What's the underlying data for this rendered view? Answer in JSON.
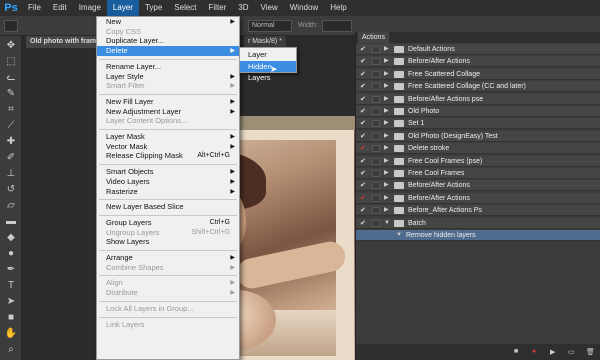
{
  "app_logo": "Ps",
  "menu": [
    "File",
    "Edit",
    "Image",
    "Layer",
    "Type",
    "Select",
    "Filter",
    "3D",
    "View",
    "Window",
    "Help"
  ],
  "active_menu": "Layer",
  "options_bar": {
    "mode_value": "Normal",
    "width_label": "Width:"
  },
  "document_tab": "Old photo with frame",
  "document_tab_suffix": "r Mask/8) *",
  "layer_menu": [
    {
      "label": "New",
      "arrow": true
    },
    {
      "label": "Copy CSS",
      "disabled": true
    },
    {
      "label": "Duplicate Layer..."
    },
    {
      "label": "Delete",
      "arrow": true,
      "highlighted": true
    },
    {
      "sep": true
    },
    {
      "label": "Rename Layer..."
    },
    {
      "label": "Layer Style",
      "arrow": true
    },
    {
      "label": "Smart Filter",
      "arrow": true,
      "disabled": true
    },
    {
      "sep": true
    },
    {
      "label": "New Fill Layer",
      "arrow": true
    },
    {
      "label": "New Adjustment Layer",
      "arrow": true
    },
    {
      "label": "Layer Content Options...",
      "disabled": true
    },
    {
      "sep": true
    },
    {
      "label": "Layer Mask",
      "arrow": true
    },
    {
      "label": "Vector Mask",
      "arrow": true
    },
    {
      "label": "Release Clipping Mask",
      "shortcut": "Alt+Ctrl+G"
    },
    {
      "sep": true
    },
    {
      "label": "Smart Objects",
      "arrow": true
    },
    {
      "label": "Video Layers",
      "arrow": true
    },
    {
      "label": "Rasterize",
      "arrow": true
    },
    {
      "sep": true
    },
    {
      "label": "New Layer Based Slice"
    },
    {
      "sep": true
    },
    {
      "label": "Group Layers",
      "shortcut": "Ctrl+G"
    },
    {
      "label": "Ungroup Layers",
      "shortcut": "Shift+Ctrl+G",
      "disabled": true
    },
    {
      "label": "Show Layers"
    },
    {
      "sep": true
    },
    {
      "label": "Arrange",
      "arrow": true
    },
    {
      "label": "Combine Shapes",
      "arrow": true,
      "disabled": true
    },
    {
      "sep": true
    },
    {
      "label": "Align",
      "arrow": true,
      "disabled": true
    },
    {
      "label": "Distribute",
      "arrow": true,
      "disabled": true
    },
    {
      "sep": true
    },
    {
      "label": "Lock All Layers in Group...",
      "disabled": true
    },
    {
      "sep": true
    },
    {
      "label": "Link Layers",
      "disabled": true
    }
  ],
  "delete_submenu": [
    {
      "label": "Layer"
    },
    {
      "label": "Hidden Layers",
      "highlighted": true
    }
  ],
  "actions_panel": {
    "title": "Actions",
    "rows": [
      {
        "label": "Default Actions",
        "check_red": false,
        "expanded": false,
        "folder": true
      },
      {
        "label": "Before/After Actions",
        "check_red": false,
        "expanded": false,
        "folder": true
      },
      {
        "label": "Free Scattered Collage",
        "check_red": false,
        "expanded": false,
        "folder": true
      },
      {
        "label": "Free Scattered Collage (CC and later)",
        "check_red": false,
        "expanded": false,
        "folder": true
      },
      {
        "label": "Before/After Actions pse",
        "check_red": false,
        "expanded": false,
        "folder": true
      },
      {
        "label": "Old Photo",
        "check_red": false,
        "expanded": false,
        "folder": true
      },
      {
        "label": "Set 1",
        "check_red": false,
        "expanded": false,
        "folder": true
      },
      {
        "label": "Old Photo (DesignEasy) Test",
        "check_red": false,
        "expanded": false,
        "folder": true
      },
      {
        "label": "Delete stroke",
        "check_red": true,
        "expanded": false,
        "folder": true
      },
      {
        "label": "Free Cool Frames (pse)",
        "check_red": false,
        "expanded": false,
        "folder": true
      },
      {
        "label": "Free Cool Frames",
        "check_red": false,
        "expanded": false,
        "folder": true
      },
      {
        "label": "Before/After Actions",
        "check_red": false,
        "expanded": false,
        "folder": true
      },
      {
        "label": "Before/After Actions",
        "check_red": true,
        "expanded": false,
        "folder": true
      },
      {
        "label": "Before_After Actions Ps",
        "check_red": false,
        "expanded": false,
        "folder": true
      },
      {
        "label": "Batch",
        "check_red": false,
        "expanded": true,
        "folder": true
      },
      {
        "label": "Remove hidden layers",
        "check_red": false,
        "expanded": true,
        "folder": false,
        "selected": true
      }
    ]
  },
  "colors": {
    "accent": "#3a8de0",
    "menubar": "#2f2f2f",
    "panel": "#454545",
    "selected_row": "#4f6c8e"
  }
}
